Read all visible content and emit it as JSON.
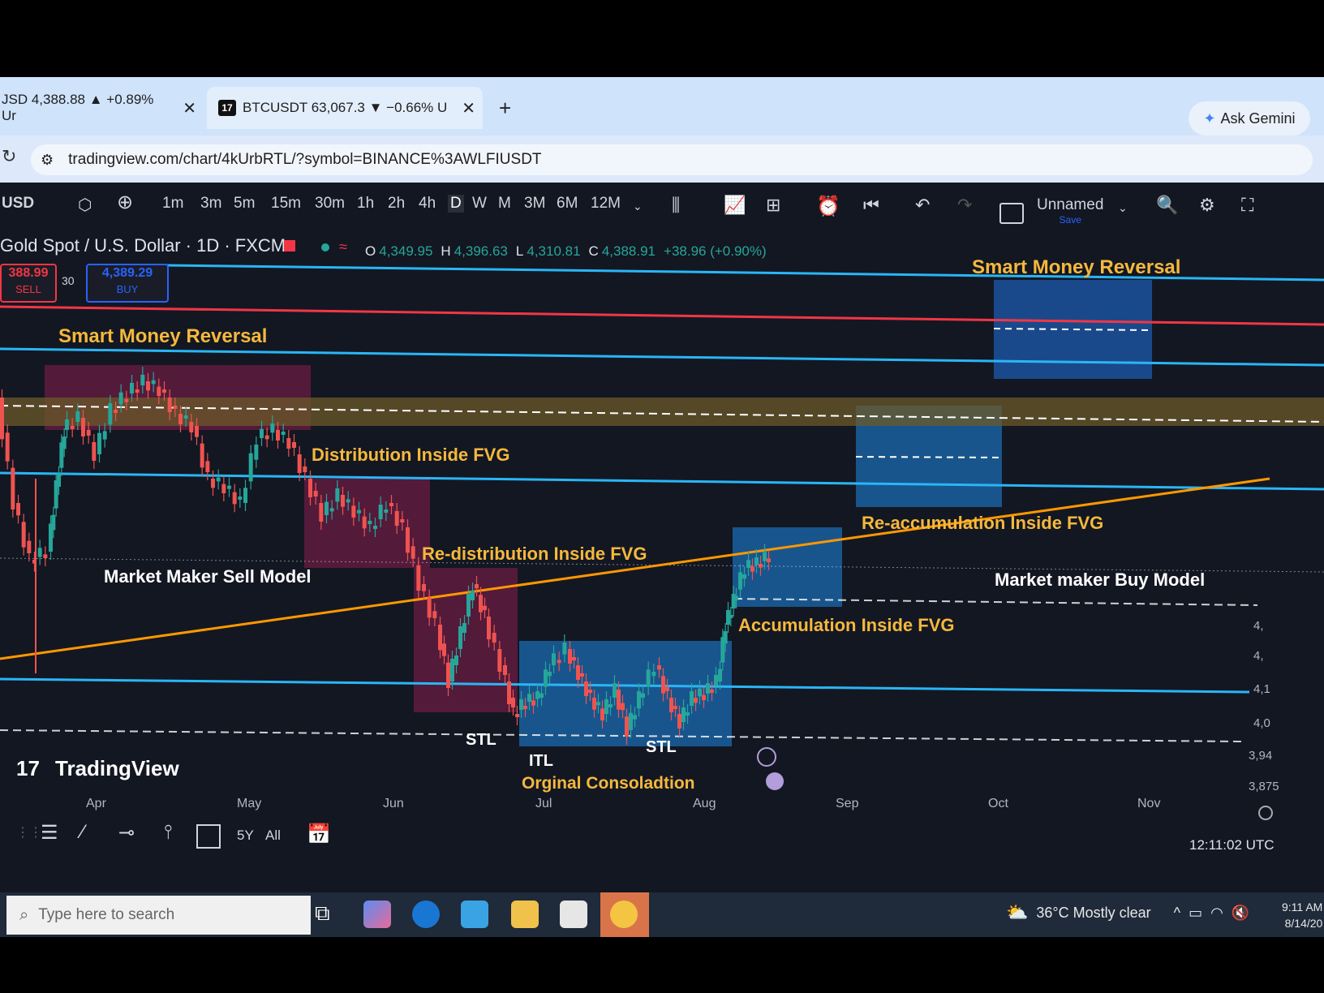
{
  "browser": {
    "tabs": [
      {
        "label": "JSD 4,388.88 ▲ +0.89% Ur"
      },
      {
        "label": "BTCUSDT 63,067.3 ▼ −0.66% U"
      }
    ],
    "new_tab": "+",
    "gemini_label": "Ask Gemini",
    "url": "tradingview.com/chart/4kUrbRTL/?symbol=BINANCE%3AWLFIUSDT"
  },
  "toolbar": {
    "symbol_short": "USD",
    "intervals": [
      "1m",
      "3m",
      "5m",
      "15m",
      "30m",
      "1h",
      "2h",
      "4h",
      "D",
      "W",
      "M",
      "3M",
      "6M",
      "12M"
    ],
    "layout_name": "Unnamed",
    "layout_sub": "Save"
  },
  "symbol": {
    "title": "Gold Spot / U.S. Dollar · 1D · FXCM",
    "open_label": "O",
    "open": "4,349.95",
    "high_label": "H",
    "high": "4,396.63",
    "low_label": "L",
    "low": "4,310.81",
    "close_label": "C",
    "close": "4,388.91",
    "change": "+38.96 (+0.90%)",
    "sell_price": "388.99",
    "sell_label": "SELL",
    "spread": "30",
    "buy_price": "4,389.29",
    "buy_label": "BUY"
  },
  "chart_data": {
    "type": "candlestick",
    "x_ticks": [
      "Apr",
      "May",
      "Jun",
      "Jul",
      "Aug",
      "Sep",
      "Oct",
      "Nov"
    ],
    "y_ticks": [
      "4,",
      "4,",
      "4,1",
      "4,0",
      "3,94",
      "3,875"
    ],
    "annotations": [
      "Smart Money Reversal",
      "Smart Money Reversal",
      "Distribution Inside FVG",
      "Market Maker Sell Model",
      "Re-distribution Inside FVG",
      "Re-accumulation Inside FVG",
      "Market maker Buy Model",
      "Accumulation Inside FVG",
      "STL",
      "ITL",
      "STL",
      "Orginal Consoladtion"
    ],
    "watermark": "TradingView",
    "colors": {
      "up": "#26a69a",
      "down": "#ef5350",
      "background": "#131722",
      "label": "#f5b83d",
      "fvg_blue": "#1e88e5",
      "fvg_pink": "#c2185b",
      "trendline": "#ff9800",
      "level_cyan": "#29b6f6",
      "level_red": "#f23645"
    }
  },
  "bottom": {
    "ranges": [
      "5Y",
      "All"
    ],
    "time": "12:11:02 UTC"
  },
  "taskbar": {
    "search_placeholder": "Type here to search",
    "weather": "36°C  Mostly clear",
    "clock_time": "9:11 AM",
    "clock_date": "8/14/20"
  }
}
